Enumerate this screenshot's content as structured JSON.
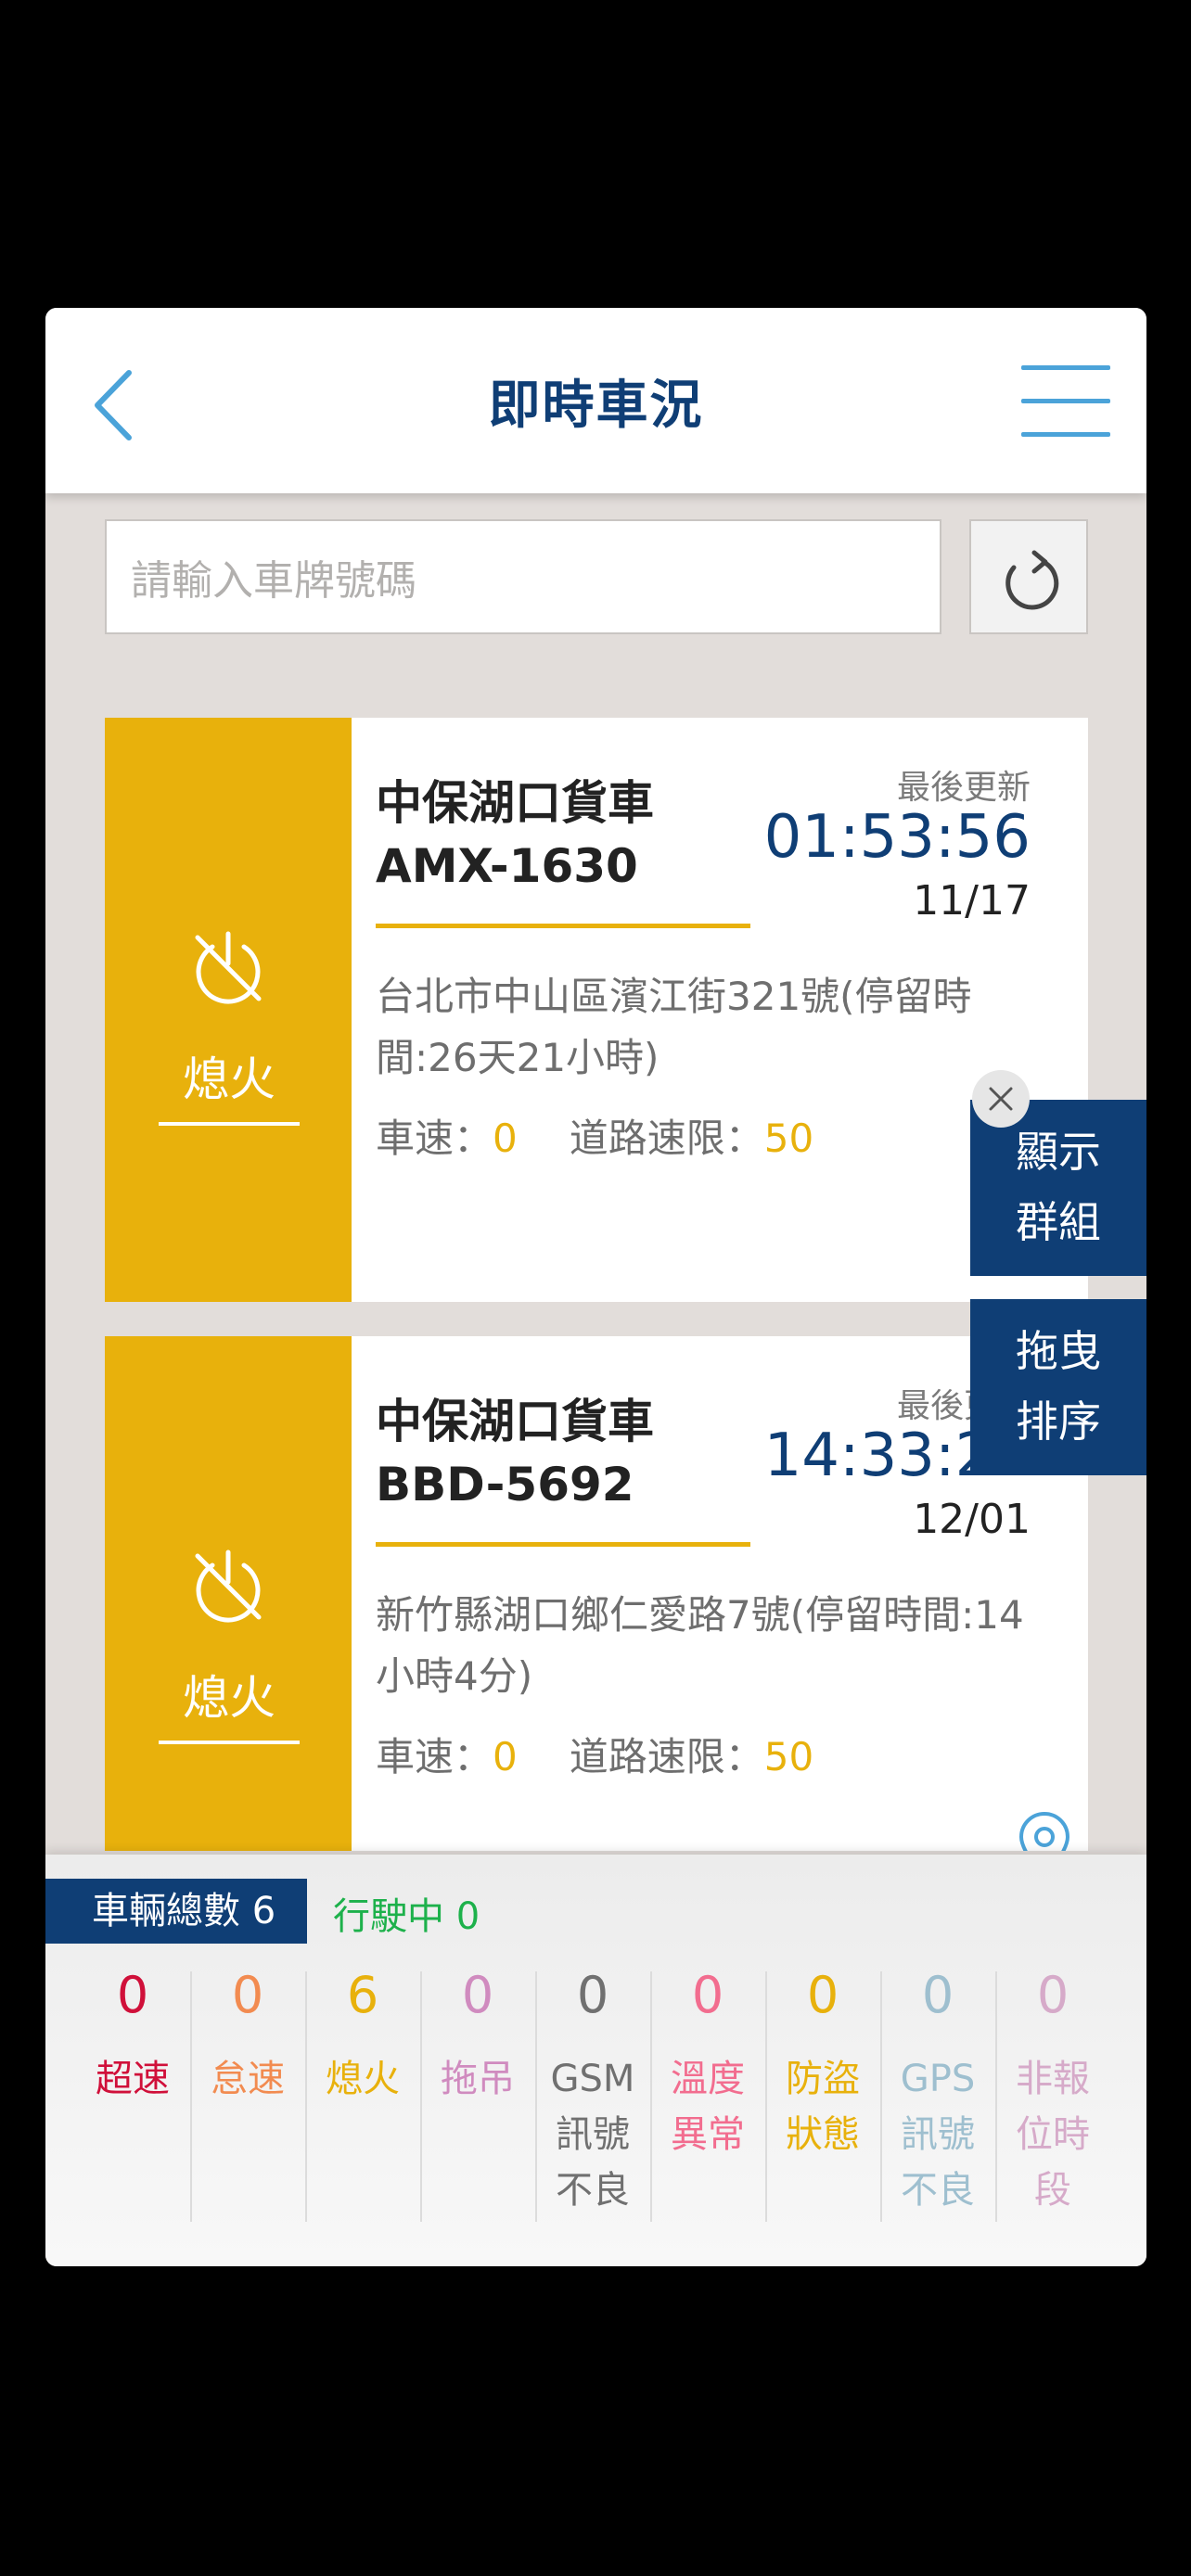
{
  "header": {
    "title": "即時車況",
    "back_icon": "chevron-left-icon",
    "menu_icon": "hamburger-menu-icon"
  },
  "search": {
    "placeholder": "請輸入車牌號碼",
    "refresh_icon": "refresh-icon"
  },
  "vehicles": [
    {
      "status": "熄火",
      "name": "中保湖口貨車",
      "plate": "AMX-1630",
      "updated_label": "最後更新",
      "updated_time": "01:53:56",
      "updated_date": "11/17",
      "address": "台北市中山區濱江街321號(停留時間:26天21小時)",
      "speed_label": "車速：",
      "speed": "0",
      "limit_label": "道路速限：",
      "limit": "50"
    },
    {
      "status": "熄火",
      "name": "中保湖口貨車",
      "plate": "BBD-5692",
      "updated_label": "最後更新",
      "updated_time": "14:33:21",
      "updated_date": "12/01",
      "address": "新竹縣湖口鄉仁愛路7號(停留時間:14小時4分)",
      "speed_label": "車速：",
      "speed": "0",
      "limit_label": "道路速限：",
      "limit": "50"
    }
  ],
  "floating": {
    "group_line1": "顯示",
    "group_line2": "群組",
    "sort_line1": "拖曳",
    "sort_line2": "排序"
  },
  "summary": {
    "total_label": "車輛總數 6",
    "moving_label": "行駛中 0",
    "stats": [
      {
        "count": "0",
        "label": "超速",
        "color": "#d0103a"
      },
      {
        "count": "0",
        "label": "怠速",
        "color": "#f28b50"
      },
      {
        "count": "6",
        "label": "熄火",
        "color": "#e8b10c"
      },
      {
        "count": "0",
        "label": "拖吊",
        "color": "#d08bbf"
      },
      {
        "count": "0",
        "label": "GSM訊號不良",
        "color": "#707070"
      },
      {
        "count": "0",
        "label": "溫度異常",
        "color": "#f26d8f"
      },
      {
        "count": "0",
        "label": "防盜狀態",
        "color": "#e8b10c"
      },
      {
        "count": "0",
        "label": "GPS訊號不良",
        "color": "#9ebfcf"
      },
      {
        "count": "0",
        "label": "非報位時段",
        "color": "#d6aac9"
      }
    ]
  }
}
